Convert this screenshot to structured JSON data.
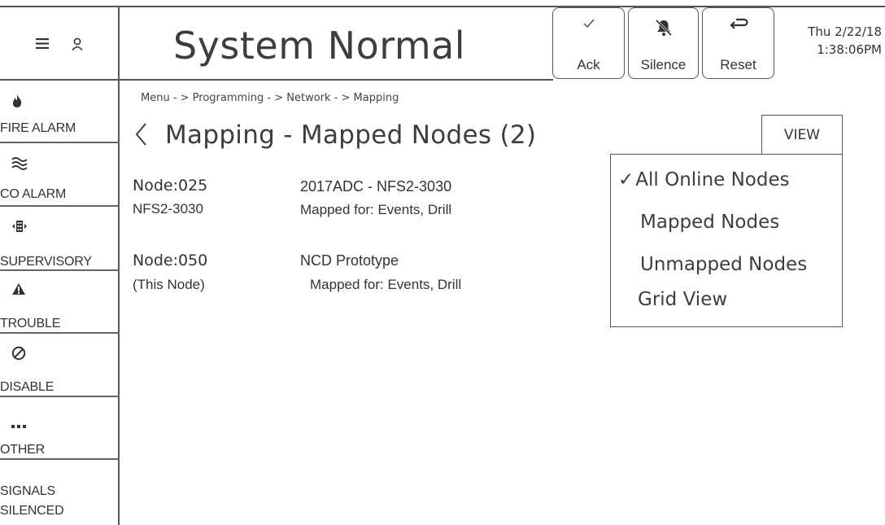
{
  "header": {
    "title": "System Normal",
    "buttons": {
      "ack": "Ack",
      "silence": "Silence",
      "reset": "Reset"
    },
    "date": "Thu 2/22/18",
    "time": "1:38:06PM"
  },
  "sidebar": {
    "items": [
      {
        "label": "FIRE ALARM",
        "icon": "flame-icon"
      },
      {
        "label": "CO ALARM",
        "icon": "waves-icon"
      },
      {
        "label": "SUPERVISORY",
        "icon": "supervisory-icon"
      },
      {
        "label": "TROUBLE",
        "icon": "warning-icon"
      },
      {
        "label": "DISABLE",
        "icon": "disable-icon"
      },
      {
        "label": "OTHER",
        "icon": "more-icon"
      },
      {
        "label_line1": "SIGNALS",
        "label_line2": "SILENCED"
      }
    ]
  },
  "main": {
    "breadcrumb": "Menu - > Programming - > Network - > Mapping",
    "title": "Mapping - Mapped Nodes (2)",
    "view_button": "VIEW",
    "nodes": [
      {
        "node": "Node:025",
        "sub": "NFS2-3030",
        "name": "2017ADC - NFS2-3030",
        "mapped": "Mapped for: Events, Drill"
      },
      {
        "node": "Node:050",
        "sub": "(This Node)",
        "name": "NCD Prototype",
        "mapped": "Mapped for: Events, Drill"
      }
    ]
  },
  "view_menu": {
    "checkmark": "✓",
    "options": [
      "All Online Nodes",
      "Mapped Nodes",
      "Unmapped Nodes",
      "Grid View"
    ],
    "selected": "All Online Nodes"
  }
}
